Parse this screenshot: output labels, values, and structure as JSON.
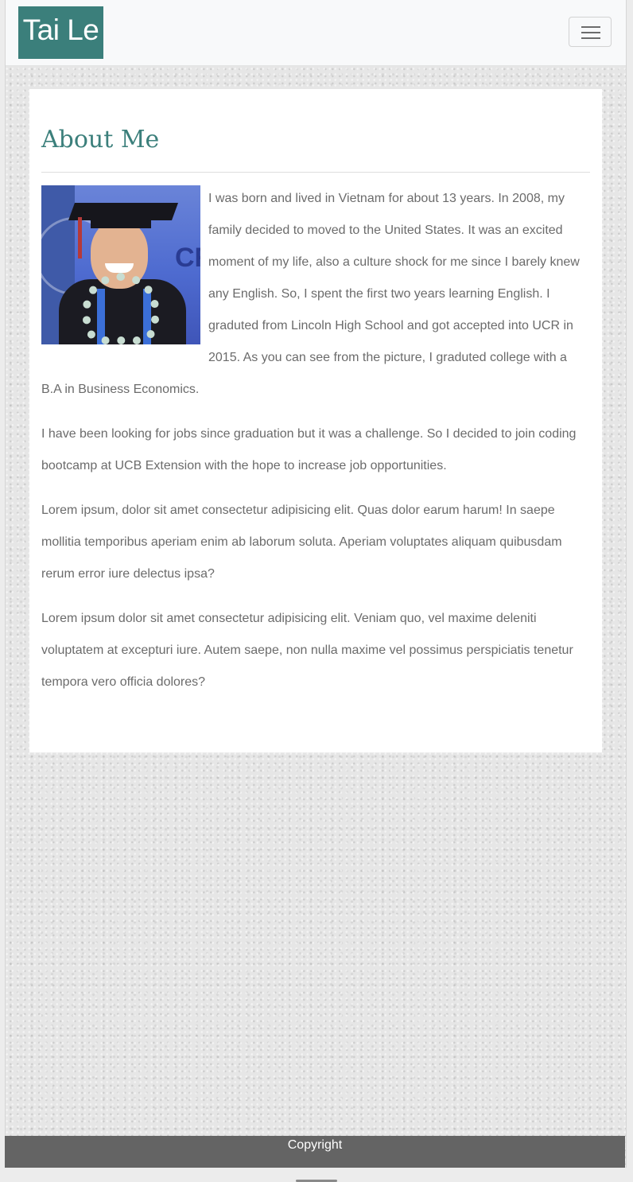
{
  "navbar": {
    "brand": "Tai Le",
    "toggler_icon": "hamburger-icon"
  },
  "main": {
    "title": "About Me",
    "photo_alt": "Graduation photo",
    "paragraphs": [
      "I was born and lived in Vietnam for about 13 years. In 2008, my family decided to moved to the United States. It was an excited moment of my life, also a culture shock for me since I barely knew any English. So, I spent the first two years learning English. I graduted from Lincoln High School and got accepted into UCR in 2015. As you can see from the picture, I graduted college with a B.A in Business Economics.",
      "I have been looking for jobs since graduation but it was a challenge. So I decided to join coding bootcamp at UCB Extension with the hope to increase job opportunities.",
      "Lorem ipsum, dolor sit amet consectetur adipisicing elit. Quas dolor earum harum! In saepe mollitia temporibus aperiam enim ab laborum soluta. Aperiam voluptates aliquam quibusdam rerum error iure delectus ipsa?",
      "Lorem ipsum dolor sit amet consectetur adipisicing elit. Veniam quo, vel maxime deleniti voluptatem at excepturi iure. Autem saepe, non nulla maxime vel possimus perspiciatis tenetur tempora vero officia dolores?"
    ]
  },
  "footer": {
    "text": "Copyright"
  },
  "colors": {
    "accent": "#3b7f7b",
    "footer_bg": "#646464",
    "text": "#6b6b6b"
  }
}
